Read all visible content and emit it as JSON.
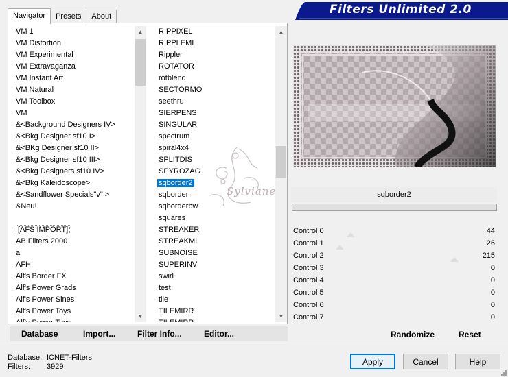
{
  "tabs": [
    {
      "label": "Navigator",
      "active": true
    },
    {
      "label": "Presets",
      "active": false
    },
    {
      "label": "About",
      "active": false
    }
  ],
  "banner": {
    "title": "Filters Unlimited 2.0"
  },
  "categories": [
    "VM 1",
    "VM Distortion",
    "VM Experimental",
    "VM Extravaganza",
    "VM Instant Art",
    "VM Natural",
    "VM Toolbox",
    "VM",
    "&<Background Designers IV>",
    "&<Bkg Designer sf10 I>",
    "&<BKg Designer sf10 II>",
    "&<Bkg Designer sf10 III>",
    "&<Bkg Designers sf10 IV>",
    "&<Bkg Kaleidoscope>",
    "&<Sandflower Specials\"v\" >",
    "&Neu!",
    "",
    "[AFS IMPORT]",
    "AB Filters 2000",
    "a",
    "AFH",
    "Alf's Border FX",
    "Alf's Power Grads",
    "Alf's Power Sines",
    "Alf's Power Toys",
    "Alf's Power Toys"
  ],
  "filters": [
    "RIPPIXEL",
    "RIPPLEMI",
    "Rippler",
    "ROTATOR",
    "rotblend",
    "SECTORMO",
    "seethru",
    "SIERPENS",
    "SINGULAR",
    "spectrum",
    "spiral4x4",
    "SPLITDIS",
    "SPYROZAG",
    "sqborder2",
    "sqborder",
    "sqborderbw",
    "squares",
    "STREAKER",
    "STREAKMI",
    "SUBNOISE",
    "SUPERINV",
    "swirl",
    "test",
    "tile",
    "TILEMIRR",
    "TILEMIRR"
  ],
  "selected_filter": "sqborder2",
  "watermark": "Sylviane",
  "list_buttons": {
    "database": "Database",
    "import": "Import...",
    "filter_info": "Filter Info...",
    "editor": "Editor..."
  },
  "controls": [
    {
      "label": "Control 0",
      "value": "44"
    },
    {
      "label": "Control 1",
      "value": "26"
    },
    {
      "label": "Control 2",
      "value": "215"
    },
    {
      "label": "Control 3",
      "value": "0"
    },
    {
      "label": "Control 4",
      "value": "0"
    },
    {
      "label": "Control 5",
      "value": "0"
    },
    {
      "label": "Control 6",
      "value": "0"
    },
    {
      "label": "Control 7",
      "value": "0"
    }
  ],
  "control_buttons": {
    "randomize": "Randomize",
    "reset": "Reset"
  },
  "footer": {
    "database_label": "Database:",
    "database_value": "ICNET-Filters",
    "filters_label": "Filters:",
    "filters_value": "3929"
  },
  "dialog_buttons": {
    "apply": "Apply",
    "cancel": "Cancel",
    "help": "Help"
  },
  "colors": {
    "banner_blue": "#0a1a8c",
    "selection": "#0078d7"
  }
}
